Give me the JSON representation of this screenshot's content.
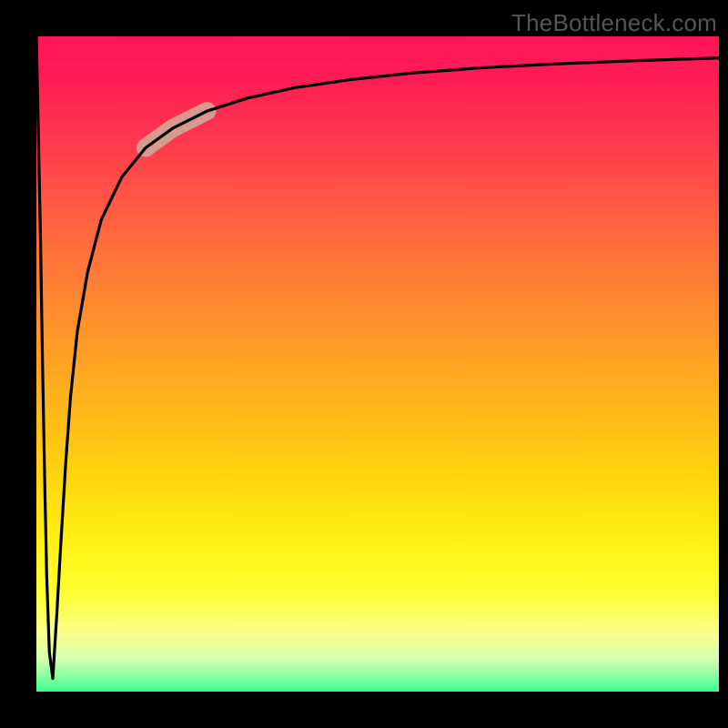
{
  "attribution": "TheBottleneck.com",
  "colors": {
    "gradient_top": "#ff1556",
    "gradient_mid": "#ffd70e",
    "gradient_bottom": "#3bff8f",
    "curve": "#000000",
    "highlight_segment": "#d69a8e",
    "frame_bg": "#000000",
    "attribution_text": "#555555"
  },
  "chart_data": {
    "type": "line",
    "title": "",
    "xlabel": "",
    "ylabel": "",
    "xlim": [
      0,
      100
    ],
    "ylim": [
      0,
      100
    ],
    "grid": false,
    "legend": false,
    "series": [
      {
        "name": "bottleneck-curve",
        "x": [
          0,
          0.6,
          0.9,
          1.2,
          1.5,
          1.9,
          2.4,
          3.0,
          3.6,
          4.3,
          5.0,
          6.0,
          7.5,
          9.5,
          12.5,
          16.0,
          20.0,
          25.0,
          31.0,
          38.0,
          46.0,
          55.0,
          65.0,
          76.0,
          88.0,
          100.0
        ],
        "values": [
          100,
          69,
          50,
          33,
          18,
          6,
          2,
          12,
          23,
          35,
          45,
          55,
          64,
          72,
          78.5,
          83,
          86,
          88.6,
          90.6,
          92.2,
          93.4,
          94.4,
          95.2,
          95.8,
          96.3,
          96.7
        ]
      }
    ],
    "highlight": {
      "x_range": [
        16.0,
        25.0
      ],
      "note": "pale salmon thickened segment on curve"
    },
    "background": "vertical heat gradient (red top → green bottom)"
  }
}
